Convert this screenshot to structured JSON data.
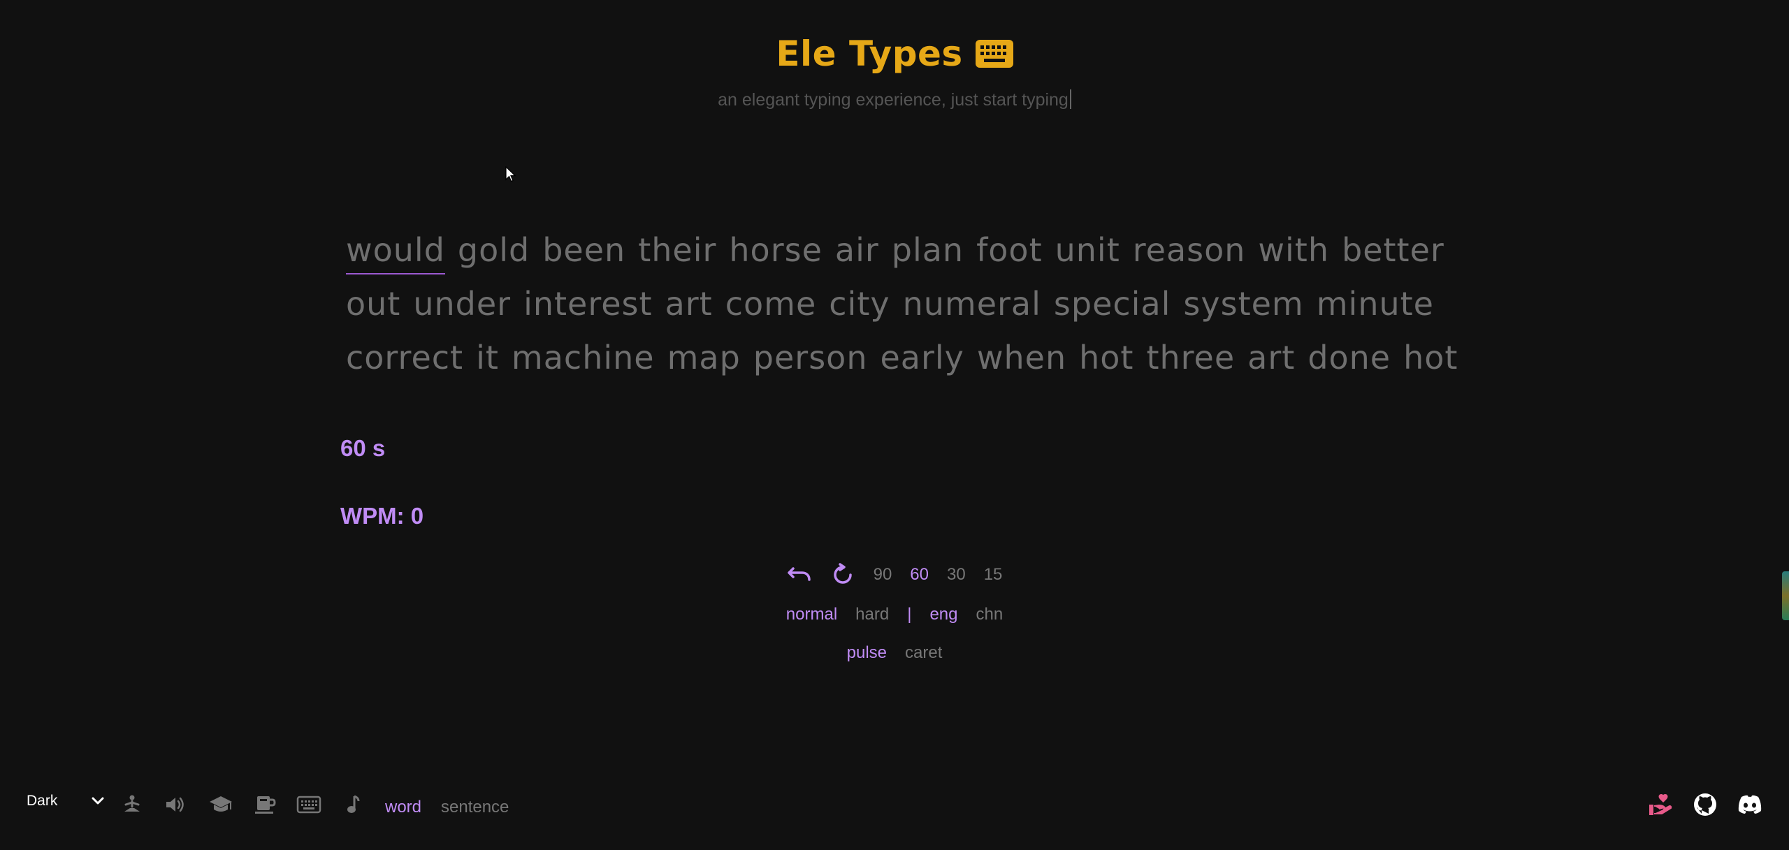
{
  "header": {
    "title": "Ele Types",
    "subtitle": "an elegant typing experience, just start typing"
  },
  "words": {
    "lines": [
      [
        "would",
        "gold",
        "been",
        "their",
        "horse",
        "air",
        "plan",
        "foot",
        "unit",
        "reason",
        "with",
        "better"
      ],
      [
        "out",
        "under",
        "interest",
        "art",
        "come",
        "city",
        "numeral",
        "special",
        "system",
        "minute"
      ],
      [
        "correct",
        "it",
        "machine",
        "map",
        "person",
        "early",
        "when",
        "hot",
        "three",
        "art",
        "done",
        "hot"
      ]
    ],
    "active_index": 0
  },
  "stats": {
    "timer": "60 s",
    "wpm": "WPM: 0"
  },
  "controls": {
    "durations": [
      {
        "label": "90",
        "active": false
      },
      {
        "label": "60",
        "active": true
      },
      {
        "label": "30",
        "active": false
      },
      {
        "label": "15",
        "active": false
      }
    ],
    "difficulty": [
      {
        "label": "normal",
        "active": true
      },
      {
        "label": "hard",
        "active": false
      }
    ],
    "separator": "|",
    "language": [
      {
        "label": "eng",
        "active": true
      },
      {
        "label": "chn",
        "active": false
      }
    ],
    "caret_style": [
      {
        "label": "pulse",
        "active": true
      },
      {
        "label": "caret",
        "active": false
      }
    ]
  },
  "footer": {
    "theme_value": "Dark",
    "modes": [
      {
        "label": "word",
        "active": true
      },
      {
        "label": "sentence",
        "active": false
      }
    ],
    "icons": [
      "zen-icon",
      "volume-icon",
      "graduation-cap-icon",
      "coffee-icon",
      "keyboard-icon",
      "music-note-icon"
    ]
  },
  "colors": {
    "background": "#111111",
    "title": "#e6a817",
    "accent": "#c08cf5",
    "muted_text": "#6f6f6f",
    "donate": "#e85a8a"
  }
}
